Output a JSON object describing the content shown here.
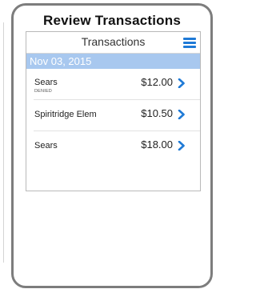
{
  "page": {
    "title": "Review Transactions"
  },
  "app": {
    "nav_title": "Transactions",
    "menu_icon": "hamburger-menu-icon",
    "accent_color": "#1f7ad6",
    "section_color": "#a8c8ef"
  },
  "section": {
    "date": "Nov 03, 2015"
  },
  "transactions": [
    {
      "merchant": "Sears",
      "status": "DENIED",
      "amount": "$12.00",
      "icon": "chevron-right-icon"
    },
    {
      "merchant": "Spiritridge Elem",
      "status": "",
      "amount": "$10.50",
      "icon": "chevron-right-icon"
    },
    {
      "merchant": "Sears",
      "status": "",
      "amount": "$18.00",
      "icon": "chevron-right-icon"
    }
  ]
}
